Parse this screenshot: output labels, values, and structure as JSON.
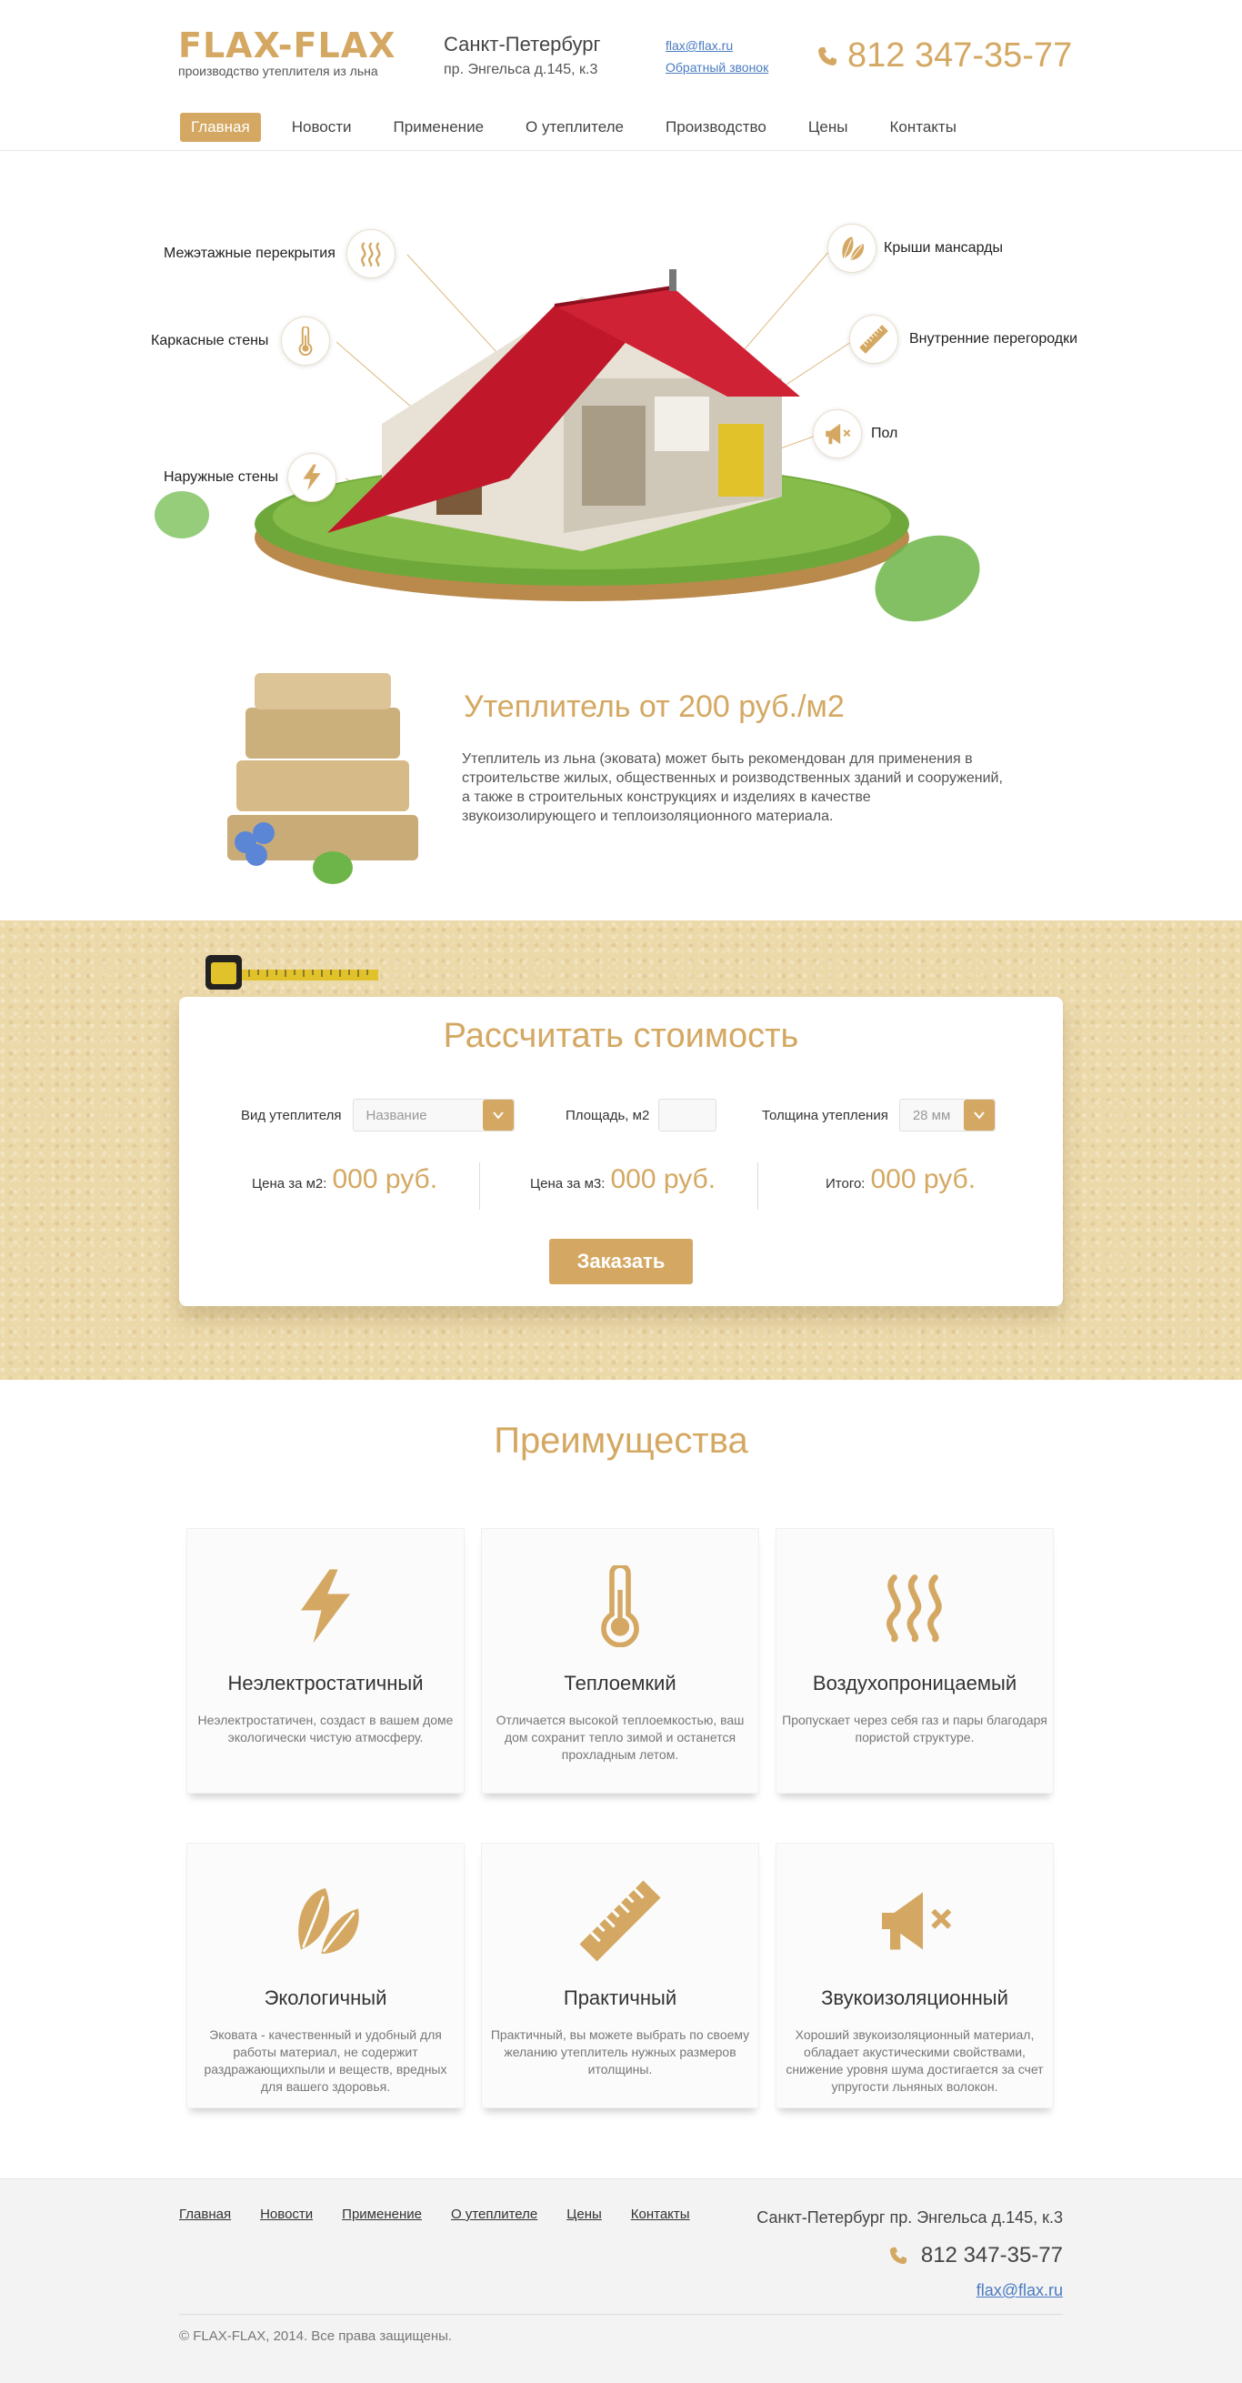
{
  "header": {
    "logo_name": "FLAX-FLAX",
    "logo_tagline": "производство утеплителя из льна",
    "city": "Санкт-Петербург",
    "street": "пр. Энгельса д.145, к.3",
    "email": "flax@flax.ru",
    "callback": "Обратный звонок",
    "phone": "812 347-35-77"
  },
  "nav": {
    "items": [
      "Главная",
      "Новости",
      "Применение",
      "О утеплителе",
      "Производство",
      "Цены",
      "Контакты"
    ],
    "active": "Главная"
  },
  "house": {
    "callouts": {
      "floors": "Межэтажные перекрытия",
      "frame_walls": "Каркасные стены",
      "outer_walls": "Наружные стены",
      "roofs": "Крыши мансарды",
      "partitions": "Внутренние перегородки",
      "floor": "Пол"
    }
  },
  "product": {
    "title": "Утеплитель от 200 руб./м2",
    "text": "Утеплитель из льна (эковата) может быть рекомендован для применения в строительстве жилых, общественных и роизводственных зданий и сооружений, а также в строительных конструкциях и изделиях в качестве звукоизолирующего и теплоизоляционного материала."
  },
  "calculator": {
    "title": "Рассчитать стоимость",
    "type_label": "Вид утеплителя",
    "type_placeholder": "Название",
    "area_label": "Площадь, м2",
    "area_value": "",
    "thickness_label": "Толщина утепления",
    "thickness_value": "28 мм",
    "price_m2_label": "Цена за м2:",
    "price_m2_value": "000 руб.",
    "price_m3_label": "Цена за м3:",
    "price_m3_value": "000 руб.",
    "total_label": "Итого:",
    "total_value": "000 руб.",
    "order_button": "Заказать"
  },
  "advantages": {
    "title": "Преимущества",
    "cards": [
      {
        "title": "Неэлектростатичный",
        "text": "Неэлектростатичен, создаст в вашем доме экологически чистую атмосферу.",
        "icon": "lightning-icon"
      },
      {
        "title": "Теплоемкий",
        "text": "Отличается высокой теплоемкостью, ваш дом сохранит тепло зимой и останется прохладным летом.",
        "icon": "thermometer-icon"
      },
      {
        "title": "Воздухопроницаемый",
        "text": "Пропускает через себя газ и пары благодаря пористой структуре.",
        "icon": "air-waves-icon"
      },
      {
        "title": "Экологичный",
        "text": "Эковата - качественный и удобный для работы материал, не содержит раздражающихпыли и веществ, вредных для вашего здоровья.",
        "icon": "leaf-icon"
      },
      {
        "title": "Практичный",
        "text": "Практичный, вы можете выбрать по своему желанию утеплитель нужных размеров итолщины.",
        "icon": "ruler-icon"
      },
      {
        "title": "Звукоизоляционный",
        "text": "Хороший звукоизоляционный материал, обладает акустическими свойствами, снижение уровня шума достигается за счет упругости льняных волокон.",
        "icon": "megaphone-mute-icon"
      }
    ]
  },
  "footer": {
    "nav": [
      "Главная",
      "Новости",
      "Применение",
      "О утеплителе",
      "Цены",
      "Контакты"
    ],
    "address": "Санкт-Петербург пр. Энгельса д.145, к.3",
    "phone": "812 347-35-77",
    "email": "flax@flax.ru",
    "copyright": "© FLAX-FLAX, 2014. Все права защищены."
  },
  "colors": {
    "accent": "#d4a862",
    "link": "#4a7bc1",
    "band": "#ecd9a9"
  }
}
